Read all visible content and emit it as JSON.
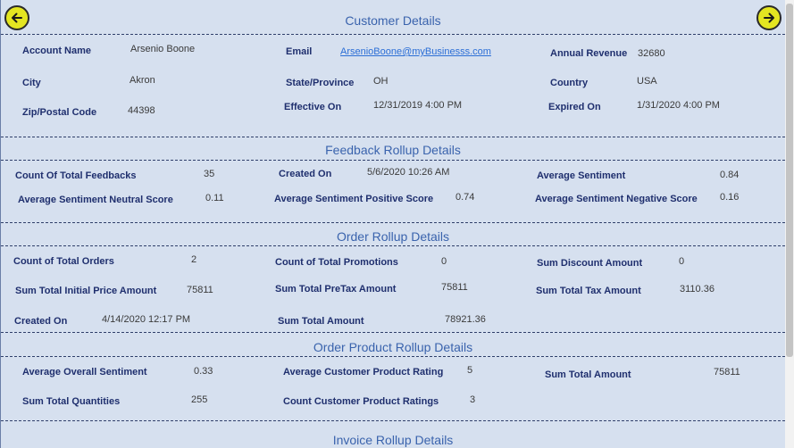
{
  "nav": {
    "back_icon": "arrow-left-icon",
    "forward_icon": "arrow-right-icon",
    "accent": "#e4e621"
  },
  "customer": {
    "title": "Customer Details",
    "account_name_label": "Account Name",
    "account_name": "Arsenio Boone",
    "email_label": "Email",
    "email": "ArsenioBoone@myBusinesss.com",
    "annual_revenue_label": "Annual Revenue",
    "annual_revenue": "32680",
    "city_label": "City",
    "city": "Akron",
    "state_label": "State/Province",
    "state": "OH",
    "country_label": "Country",
    "country": "USA",
    "zip_label": "Zip/Postal Code",
    "zip": "44398",
    "effective_label": "Effective On",
    "effective": "12/31/2019 4:00 PM",
    "expired_label": "Expired On",
    "expired": "1/31/2020 4:00 PM"
  },
  "feedback": {
    "title": "Feedback Rollup Details",
    "count_label": "Count Of Total Feedbacks",
    "count": "35",
    "created_label": "Created On",
    "created": "5/6/2020 10:26 AM",
    "avg_label": "Average Sentiment",
    "avg": "0.84",
    "neutral_label": "Average Sentiment Neutral Score",
    "neutral": "0.11",
    "positive_label": "Average Sentiment Positive Score",
    "positive": "0.74",
    "negative_label": "Average Sentiment Negative Score",
    "negative": "0.16"
  },
  "order": {
    "title": "Order Rollup Details",
    "count_label": "Count of Total Orders",
    "count": "2",
    "promotions_label": "Count of Total Promotions",
    "promotions": "0",
    "discount_label": "Sum Discount Amount",
    "discount": "0",
    "initial_label": "Sum Total Initial Price Amount",
    "initial": "75811",
    "pretax_label": "Sum Total PreTax Amount",
    "pretax": "75811",
    "tax_label": "Sum Total Tax Amount",
    "tax": "3110.36",
    "created_label": "Created On",
    "created": "4/14/2020 12:17 PM",
    "total_label": "Sum Total Amount",
    "total": "78921.36"
  },
  "order_product": {
    "title": "Order Product Rollup Details",
    "avg_label": "Average Overall Sentiment",
    "avg": "0.33",
    "rating_label": "Average Customer Product Rating",
    "rating": "5",
    "total_label": "Sum Total Amount",
    "total": "75811",
    "quantities_label": "Sum Total Quantities",
    "quantities": "255",
    "ratings_count_label": "Count Customer Product Ratings",
    "ratings_count": "3"
  },
  "invoice": {
    "title": "Invoice Rollup Details"
  }
}
